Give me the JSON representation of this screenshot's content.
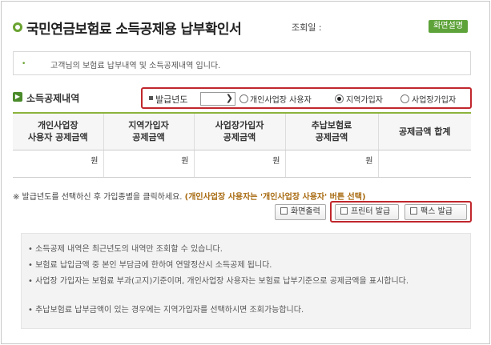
{
  "header": {
    "title": "국민연금보험료 소득공제용 납부확인서",
    "inquiry_label": "조회일 :",
    "help_button": "화면설명"
  },
  "notice": {
    "bullet": "•",
    "text": "고객님의 보험료 납부내역 및 소득공제내역 입니다."
  },
  "section": {
    "title": "소득공제내역"
  },
  "filter": {
    "year_label": "발급년도",
    "year_value": "",
    "options": [
      {
        "label": "개인사업장 사용자",
        "checked": false
      },
      {
        "label": "지역가입자",
        "checked": true
      },
      {
        "label": "사업장가입자",
        "checked": false
      }
    ]
  },
  "table": {
    "headers": [
      [
        "개인사업장",
        "사용자 공제금액"
      ],
      [
        "지역가입자",
        "공제금액"
      ],
      [
        "사업장가입자",
        "공제금액"
      ],
      [
        "추납보험료",
        "공제금액"
      ],
      [
        "공제금액 합계",
        ""
      ]
    ],
    "row": [
      "원",
      "원",
      "원",
      "원",
      ""
    ]
  },
  "guide": {
    "text": "※ 발급년도를 선택하신 후 가입종별을 클릭하세요.",
    "highlight": "(개인사업장 사용자는 '개인사업장 사용자' 버튼 선택)"
  },
  "buttons": {
    "screen_print": "화면출력",
    "printer_issue": "프린터 발급",
    "fax_issue": "팩스 발급"
  },
  "info": [
    "• 소득공제 내역은 최근년도의 내역만 조회할 수 있습니다.",
    "• 보험료 납입금액 중 본인 부담금에 한하여 연말정산시 소득공제 됩니다.",
    "• 사업장 가입자는 보험료 부과(고지)기준이며, 개인사업장 사용자는 보험료 납부기준으로 공제금액을 표시합니다.",
    "• 추납보험료 납부금액이 있는 경우에는 지역가입자를 선택하시면 조회가능합니다."
  ],
  "colors": {
    "accent_green": "#6aa331",
    "highlight_red": "#c0272d"
  }
}
